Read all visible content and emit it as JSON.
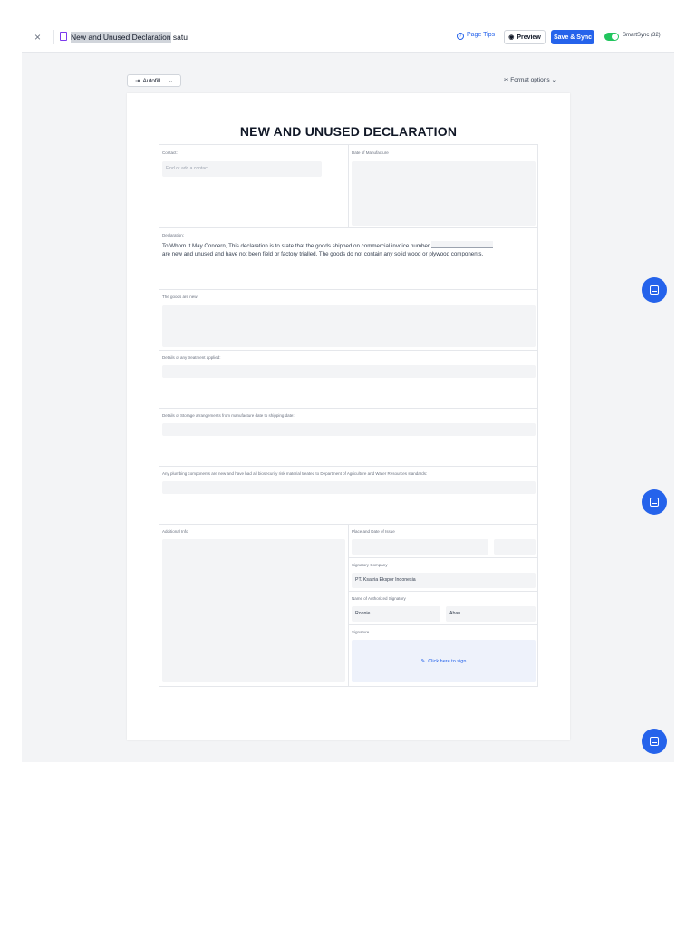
{
  "topbar": {
    "close_glyph": "×",
    "doc_title_selected": "New and Unused Declaration",
    "doc_title_rest": " satu",
    "page_tips": "Page Tips",
    "preview": "Preview",
    "save_sync": "Save & Sync",
    "smartsync": "SmartSync (32)"
  },
  "toolbar": {
    "autofill": "Autofill...",
    "format_options": "Format options"
  },
  "form": {
    "title": "NEW AND UNUSED DECLARATION",
    "contact_label": "Contact:",
    "contact_placeholder": "Find or add a contact...",
    "date_manufacture_label": "Date of Manufacture",
    "declaration_label": "Declaration:",
    "declaration_text_1": "To Whom It May Concern, This declaration is to state that the goods shipped on commercial invoice number",
    "declaration_text_2": "are new and unused and have not been field or factory trialled. The goods do not contain any solid wood or plywood components.",
    "goods_new_label": "The goods are new:",
    "treatment_label": "Details of any treatment applied:",
    "storage_label": "Details of Storage arrangements from manufacture date to shipping date:",
    "plumbing_label": "Any plumbing components are new and have had all biosecurity risk material treated to Department of Agriculture and Water Resources standards:",
    "additional_info_label": "Additional Info",
    "place_date_label": "Place and Date of Issue",
    "signatory_company_label": "Signatory Company",
    "signatory_company_value": "PT. Ksatria Ekspor Indonesia",
    "authorized_signatory_label": "Name of Authorized Signatory",
    "first_name": "Ronnie",
    "last_name": "Aban",
    "signature_label": "Signature",
    "sign_prompt": "Click here to sign"
  },
  "colors": {
    "accent": "#2563eb",
    "toggle_on": "#22c55e",
    "field_bg": "#f3f4f6"
  },
  "icons": [
    "close-icon",
    "document-icon",
    "help-circle-icon",
    "eye-icon",
    "autofill-icon",
    "chevron-down-icon",
    "format-icon",
    "pen-icon",
    "chat-icon"
  ]
}
